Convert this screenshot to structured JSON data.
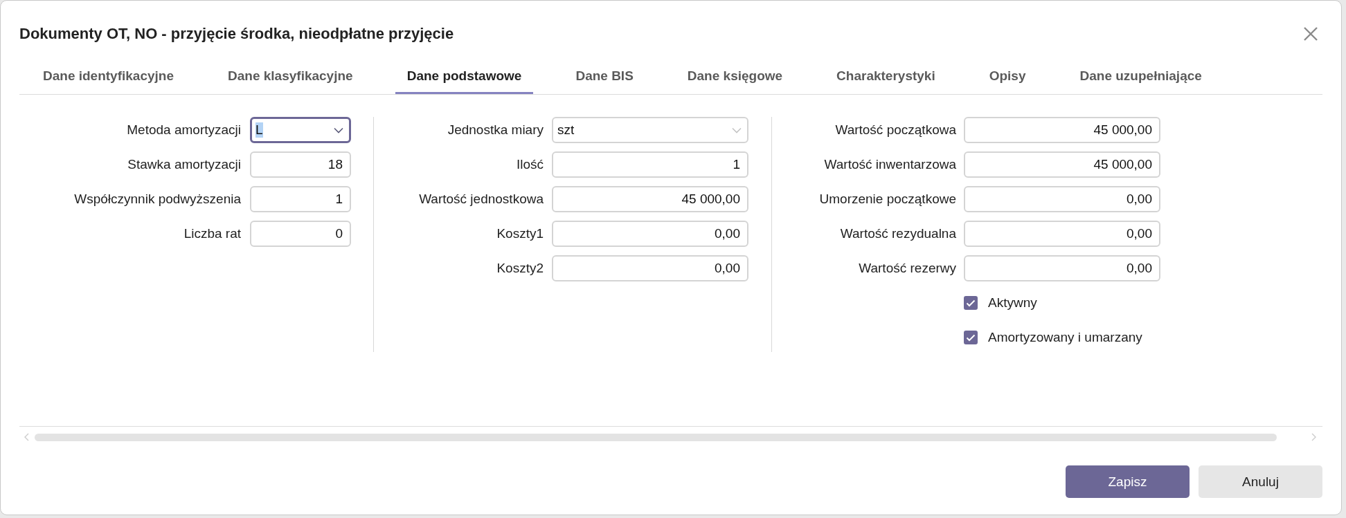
{
  "window": {
    "title": "Dokumenty OT, NO - przyjęcie środka, nieodpłatne przyjęcie"
  },
  "tabs": [
    {
      "label": "Dane identyfikacyjne",
      "selected": false
    },
    {
      "label": "Dane klasyfikacyjne",
      "selected": false
    },
    {
      "label": "Dane podstawowe",
      "selected": true
    },
    {
      "label": "Dane BIS",
      "selected": false
    },
    {
      "label": "Dane księgowe",
      "selected": false
    },
    {
      "label": "Charakterystyki",
      "selected": false
    },
    {
      "label": "Opisy",
      "selected": false
    },
    {
      "label": "Dane uzupełniające",
      "selected": false
    }
  ],
  "columns": [
    {
      "fields": [
        {
          "label": "Metoda amortyzacji",
          "value": "L",
          "kind": "select",
          "focused": true
        },
        {
          "label": "Stawka amortyzacji",
          "value": "18",
          "kind": "number",
          "focused": false
        },
        {
          "label": "Współczynnik podwyższenia",
          "value": "1",
          "kind": "number",
          "focused": false
        },
        {
          "label": "Liczba rat",
          "value": "0",
          "kind": "number",
          "focused": false
        }
      ]
    },
    {
      "fields": [
        {
          "label": "Jednostka miary",
          "value": "szt",
          "kind": "select",
          "focused": false
        },
        {
          "label": "Ilość",
          "value": "1",
          "kind": "number",
          "focused": false
        },
        {
          "label": "Wartość jednostkowa",
          "value": "45 000,00",
          "kind": "number",
          "focused": false
        },
        {
          "label": "Koszty1",
          "value": "0,00",
          "kind": "number",
          "focused": false
        },
        {
          "label": "Koszty2",
          "value": "0,00",
          "kind": "number",
          "focused": false
        }
      ]
    },
    {
      "fields": [
        {
          "label": "Wartość początkowa",
          "value": "45 000,00",
          "kind": "number",
          "focused": false
        },
        {
          "label": "Wartość inwentarzowa",
          "value": "45 000,00",
          "kind": "number",
          "focused": false
        },
        {
          "label": "Umorzenie początkowe",
          "value": "0,00",
          "kind": "number",
          "focused": false
        },
        {
          "label": "Wartość rezydualna",
          "value": "0,00",
          "kind": "number",
          "focused": false
        },
        {
          "label": "Wartość rezerwy",
          "value": "0,00",
          "kind": "number",
          "focused": false
        }
      ],
      "checkboxes": [
        {
          "label": "Aktywny",
          "checked": true
        },
        {
          "label": "Amortyzowany i umarzany",
          "checked": true
        }
      ]
    }
  ],
  "buttons": [
    {
      "label": "Zapisz",
      "kind": "primary"
    },
    {
      "label": "Anuluj",
      "kind": "secondary"
    }
  ]
}
